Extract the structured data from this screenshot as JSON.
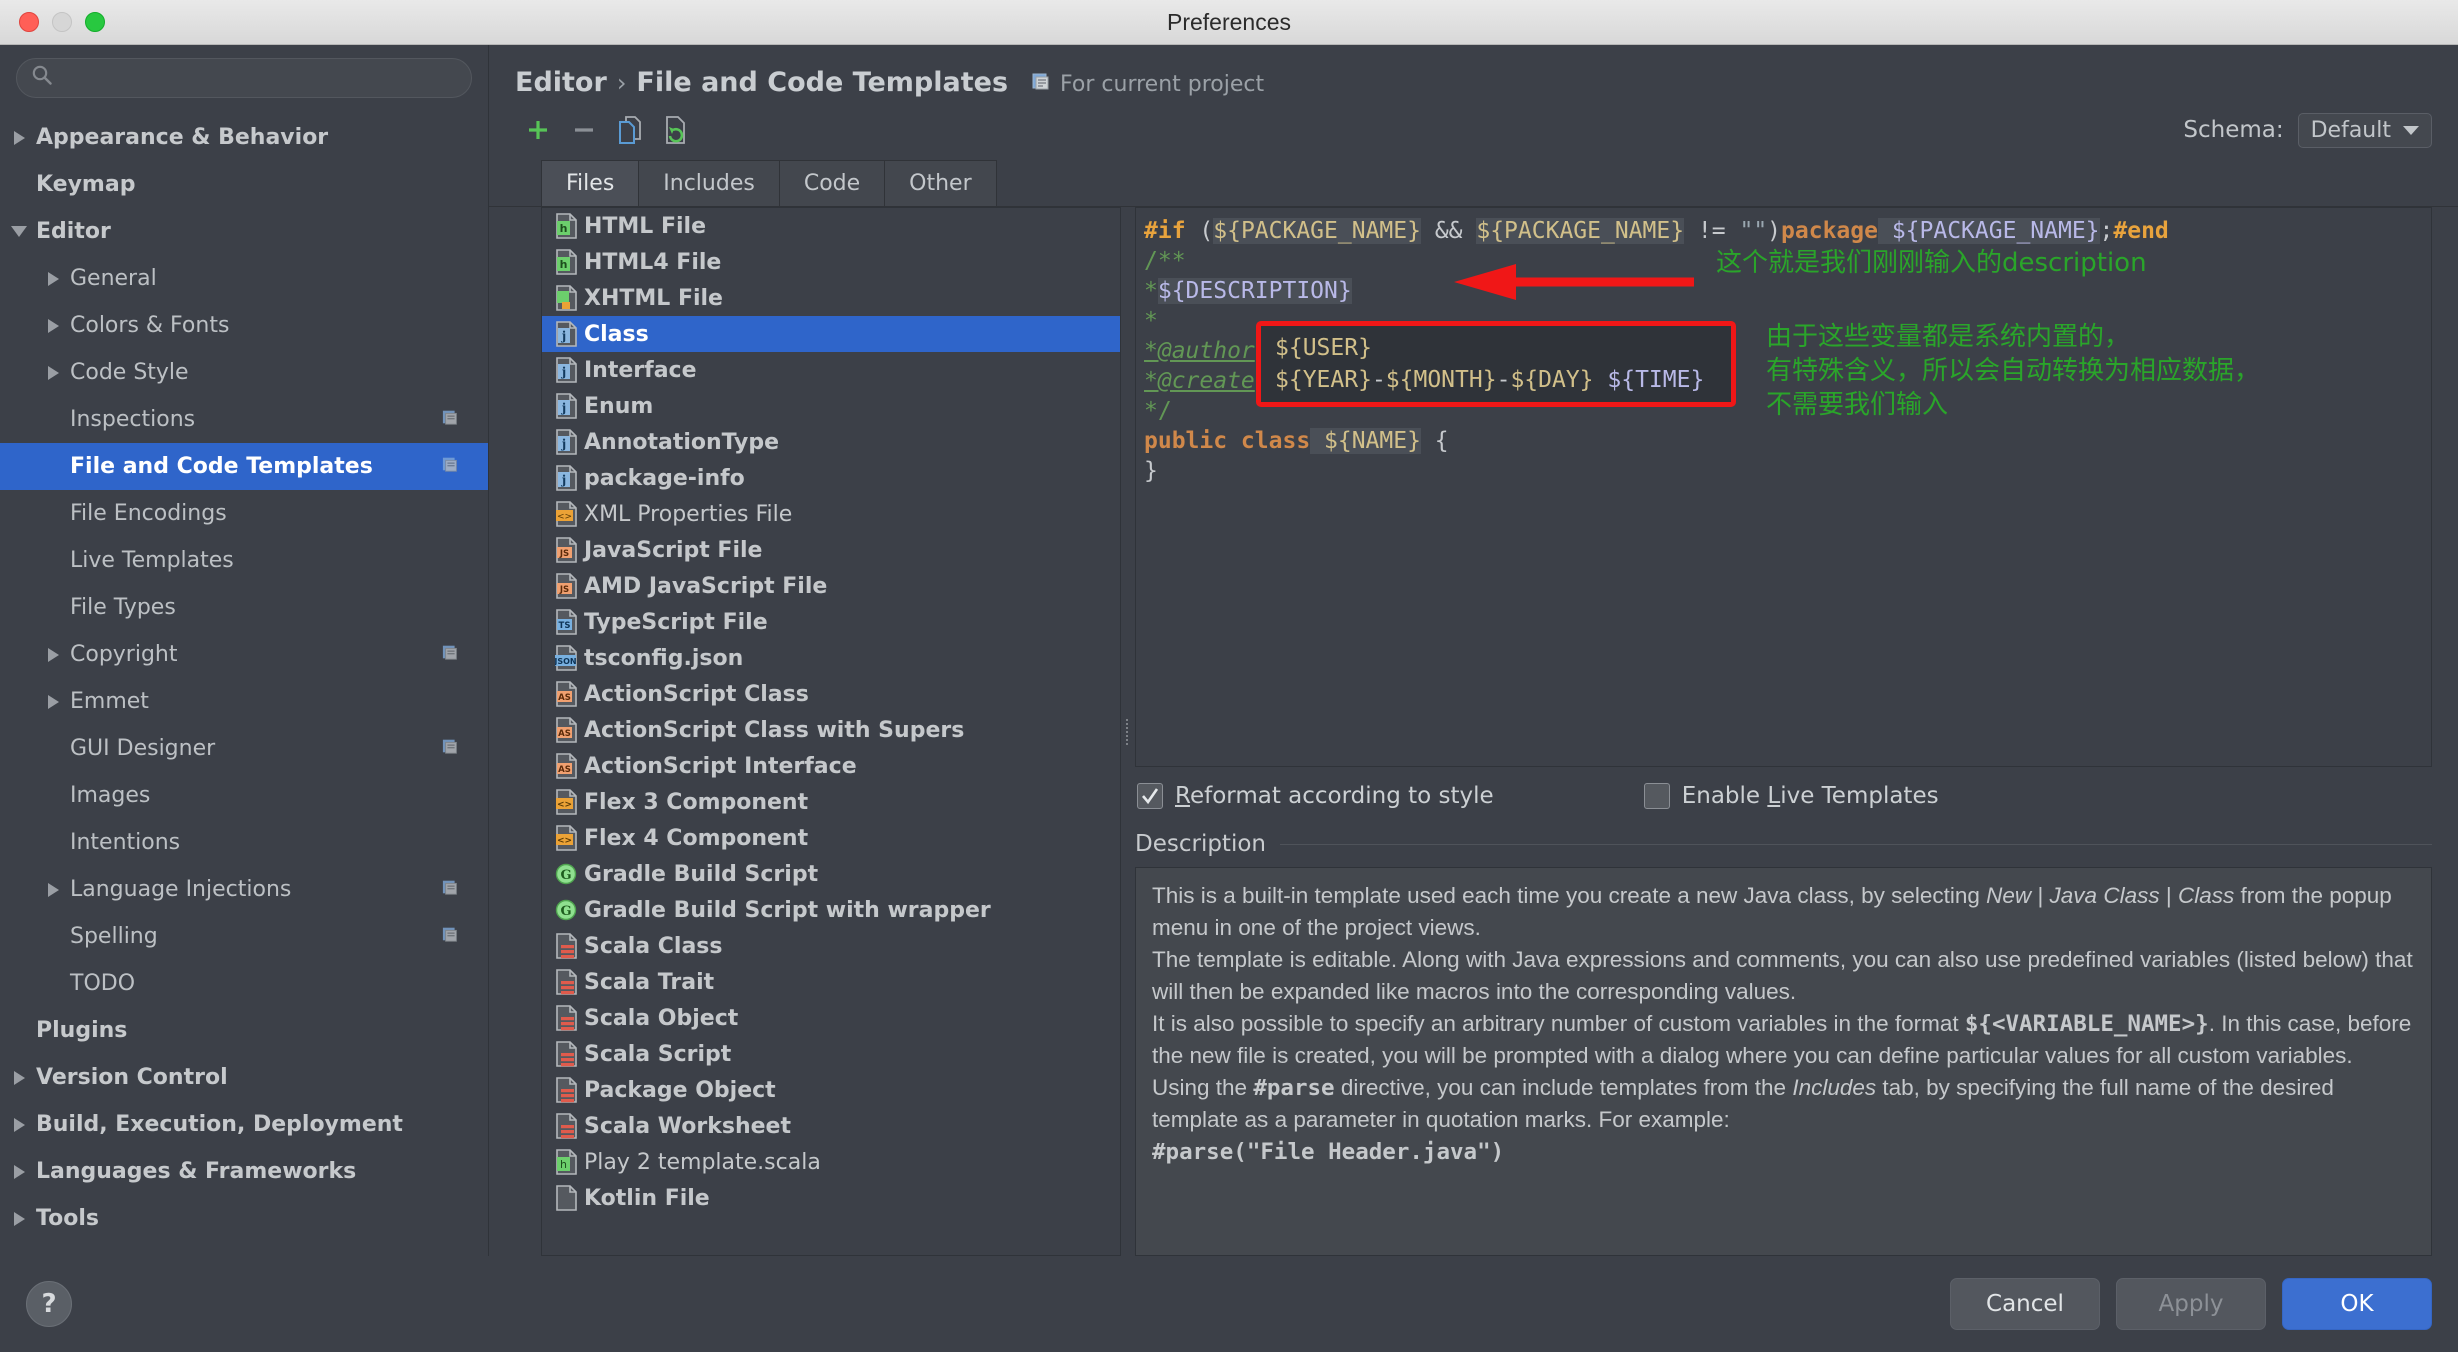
{
  "window": {
    "title": "Preferences"
  },
  "search": {
    "value": "",
    "placeholder": ""
  },
  "sidebar": {
    "items": [
      {
        "label": "Appearance & Behavior",
        "level": 0,
        "arrow": "right",
        "bold": true,
        "selected": false,
        "badge": false
      },
      {
        "label": "Keymap",
        "level": 0,
        "arrow": "none",
        "bold": true,
        "selected": false,
        "badge": false
      },
      {
        "label": "Editor",
        "level": 0,
        "arrow": "down",
        "bold": true,
        "selected": false,
        "badge": false
      },
      {
        "label": "General",
        "level": 1,
        "arrow": "right",
        "bold": false,
        "selected": false,
        "badge": false
      },
      {
        "label": "Colors & Fonts",
        "level": 1,
        "arrow": "right",
        "bold": false,
        "selected": false,
        "badge": false
      },
      {
        "label": "Code Style",
        "level": 1,
        "arrow": "right",
        "bold": false,
        "selected": false,
        "badge": false
      },
      {
        "label": "Inspections",
        "level": 1,
        "arrow": "none",
        "bold": false,
        "selected": false,
        "badge": true
      },
      {
        "label": "File and Code Templates",
        "level": 1,
        "arrow": "none",
        "bold": true,
        "selected": true,
        "badge": true
      },
      {
        "label": "File Encodings",
        "level": 1,
        "arrow": "none",
        "bold": false,
        "selected": false,
        "badge": false
      },
      {
        "label": "Live Templates",
        "level": 1,
        "arrow": "none",
        "bold": false,
        "selected": false,
        "badge": false
      },
      {
        "label": "File Types",
        "level": 1,
        "arrow": "none",
        "bold": false,
        "selected": false,
        "badge": false
      },
      {
        "label": "Copyright",
        "level": 1,
        "arrow": "right",
        "bold": false,
        "selected": false,
        "badge": true
      },
      {
        "label": "Emmet",
        "level": 1,
        "arrow": "right",
        "bold": false,
        "selected": false,
        "badge": false
      },
      {
        "label": "GUI Designer",
        "level": 1,
        "arrow": "none",
        "bold": false,
        "selected": false,
        "badge": true
      },
      {
        "label": "Images",
        "level": 1,
        "arrow": "none",
        "bold": false,
        "selected": false,
        "badge": false
      },
      {
        "label": "Intentions",
        "level": 1,
        "arrow": "none",
        "bold": false,
        "selected": false,
        "badge": false
      },
      {
        "label": "Language Injections",
        "level": 1,
        "arrow": "right",
        "bold": false,
        "selected": false,
        "badge": true
      },
      {
        "label": "Spelling",
        "level": 1,
        "arrow": "none",
        "bold": false,
        "selected": false,
        "badge": true
      },
      {
        "label": "TODO",
        "level": 1,
        "arrow": "none",
        "bold": false,
        "selected": false,
        "badge": false
      },
      {
        "label": "Plugins",
        "level": 0,
        "arrow": "none",
        "bold": true,
        "selected": false,
        "badge": false
      },
      {
        "label": "Version Control",
        "level": 0,
        "arrow": "right",
        "bold": true,
        "selected": false,
        "badge": false
      },
      {
        "label": "Build, Execution, Deployment",
        "level": 0,
        "arrow": "right",
        "bold": true,
        "selected": false,
        "badge": false
      },
      {
        "label": "Languages & Frameworks",
        "level": 0,
        "arrow": "right",
        "bold": true,
        "selected": false,
        "badge": false
      },
      {
        "label": "Tools",
        "level": 0,
        "arrow": "right",
        "bold": true,
        "selected": false,
        "badge": false
      }
    ]
  },
  "header": {
    "crumb_root": "Editor",
    "crumb_sep": "›",
    "crumb_leaf": "File and Code Templates",
    "scope_label": "For current project",
    "schema_label": "Schema:",
    "schema_value": "Default"
  },
  "toolbar": {
    "add_title": "+",
    "remove_title": "−",
    "copy_title": "copy",
    "reset_title": "reset"
  },
  "tabs": [
    {
      "label": "Files",
      "active": true
    },
    {
      "label": "Includes",
      "active": false
    },
    {
      "label": "Code",
      "active": false
    },
    {
      "label": "Other",
      "active": false
    }
  ],
  "filelist": [
    {
      "label": "HTML File",
      "icon": "html",
      "selected": false,
      "bold": true
    },
    {
      "label": "HTML4 File",
      "icon": "html",
      "selected": false,
      "bold": true
    },
    {
      "label": "XHTML File",
      "icon": "xhtml",
      "selected": false,
      "bold": true
    },
    {
      "label": "Class",
      "icon": "java",
      "selected": true,
      "bold": true
    },
    {
      "label": "Interface",
      "icon": "java",
      "selected": false,
      "bold": true
    },
    {
      "label": "Enum",
      "icon": "java",
      "selected": false,
      "bold": true
    },
    {
      "label": "AnnotationType",
      "icon": "java",
      "selected": false,
      "bold": true
    },
    {
      "label": "package-info",
      "icon": "java",
      "selected": false,
      "bold": true
    },
    {
      "label": "XML Properties File",
      "icon": "xml",
      "selected": false,
      "bold": false
    },
    {
      "label": "JavaScript File",
      "icon": "js",
      "selected": false,
      "bold": true
    },
    {
      "label": "AMD JavaScript File",
      "icon": "js",
      "selected": false,
      "bold": true
    },
    {
      "label": "TypeScript File",
      "icon": "ts",
      "selected": false,
      "bold": true
    },
    {
      "label": "tsconfig.json",
      "icon": "json",
      "selected": false,
      "bold": true
    },
    {
      "label": "ActionScript Class",
      "icon": "as",
      "selected": false,
      "bold": true
    },
    {
      "label": "ActionScript Class with Supers",
      "icon": "as",
      "selected": false,
      "bold": true
    },
    {
      "label": "ActionScript Interface",
      "icon": "as",
      "selected": false,
      "bold": true
    },
    {
      "label": "Flex 3 Component",
      "icon": "flex",
      "selected": false,
      "bold": true
    },
    {
      "label": "Flex 4 Component",
      "icon": "flex",
      "selected": false,
      "bold": true
    },
    {
      "label": "Gradle Build Script",
      "icon": "gradle",
      "selected": false,
      "bold": true
    },
    {
      "label": "Gradle Build Script with wrapper",
      "icon": "gradle",
      "selected": false,
      "bold": true
    },
    {
      "label": "Scala Class",
      "icon": "scala",
      "selected": false,
      "bold": true
    },
    {
      "label": "Scala Trait",
      "icon": "scala",
      "selected": false,
      "bold": true
    },
    {
      "label": "Scala Object",
      "icon": "scala",
      "selected": false,
      "bold": true
    },
    {
      "label": "Scala Script",
      "icon": "scala",
      "selected": false,
      "bold": true
    },
    {
      "label": "Package Object",
      "icon": "scala",
      "selected": false,
      "bold": true
    },
    {
      "label": "Scala Worksheet",
      "icon": "scala",
      "selected": false,
      "bold": true
    },
    {
      "label": "Play 2 template.scala",
      "icon": "html",
      "selected": false,
      "bold": false
    },
    {
      "label": "Kotlin File",
      "icon": "kotlin",
      "selected": false,
      "bold": true
    }
  ],
  "editor": {
    "line1": {
      "directive": "#if",
      "open": " (",
      "var1": "${PACKAGE_NAME}",
      "and": " && ",
      "var2": "${PACKAGE_NAME}",
      "neq": " != ",
      "empty": "\"\"",
      "close": ")",
      "kw": "package",
      "var3": " ${PACKAGE_NAME}",
      "semi": ";",
      "end": "#end"
    },
    "line2": "/**",
    "line3_star": "*",
    "line3_var": "${DESCRIPTION}",
    "line4": "*",
    "line5_tag": "*@author",
    "line6_tag": "*@create",
    "line7": "*/",
    "line8_kw": "public class",
    "line8_var": " ${NAME}",
    "line8_brace": " {",
    "line9": "}"
  },
  "annotations": {
    "note1": "这个就是我们刚刚输入的description",
    "note2": "由于这些变量都是系统内置的，\n有特殊含义，所以会自动转换为相应数据，\n不需要我们输入",
    "redbox_line1": "${USER}",
    "redbox_line2_year": "${YEAR}",
    "redbox_line2_d1": "-",
    "redbox_line2_month": "${MONTH}",
    "redbox_line2_d2": "-",
    "redbox_line2_day": "${DAY}",
    "redbox_line2_time": " ${TIME}"
  },
  "options": {
    "reformat_label_u": "R",
    "reformat_label_rest": "eformat according to style",
    "reformat_checked": true,
    "live_label_pre": "Enable ",
    "live_label_u": "L",
    "live_label_rest": "ive Templates",
    "live_checked": false
  },
  "description": {
    "legend": "Description",
    "p1_a": "This is a built-in template used each time you create a new Java class, by selecting ",
    "p1_new": "New",
    "p1_b": " | ",
    "p1_javaclass": "Java Class",
    "p1_c": " | ",
    "p1_class": "Class",
    "p1_d": " from the popup menu in one of the project views.",
    "p2": "The template is editable. Along with Java expressions and comments, you can also use predefined variables (listed below) that will then be expanded like macros into the corresponding values.",
    "p3_a": "It is also possible to specify an arbitrary number of custom variables in the format ",
    "p3_var": "${<VARIABLE_NAME>}",
    "p3_b": ". In this case, before the new file is created, you will be prompted with a dialog where you can define particular values for all custom variables.",
    "p4_a": "Using the ",
    "p4_parse": "#parse",
    "p4_b": " directive, you can include templates from the ",
    "p4_includes": "Includes",
    "p4_c": " tab, by specifying the full name of the desired template as a parameter in quotation marks. For example:",
    "p5": "#parse(\"File Header.java\")"
  },
  "footer": {
    "help_label": "?",
    "cancel_label": "Cancel",
    "apply_label": "Apply",
    "ok_label": "OK"
  },
  "colors": {
    "accent": "#2f65ca",
    "primary_button": "#3c6fd0",
    "annotation_green": "#2aa52a",
    "annotation_red": "#f01717"
  }
}
